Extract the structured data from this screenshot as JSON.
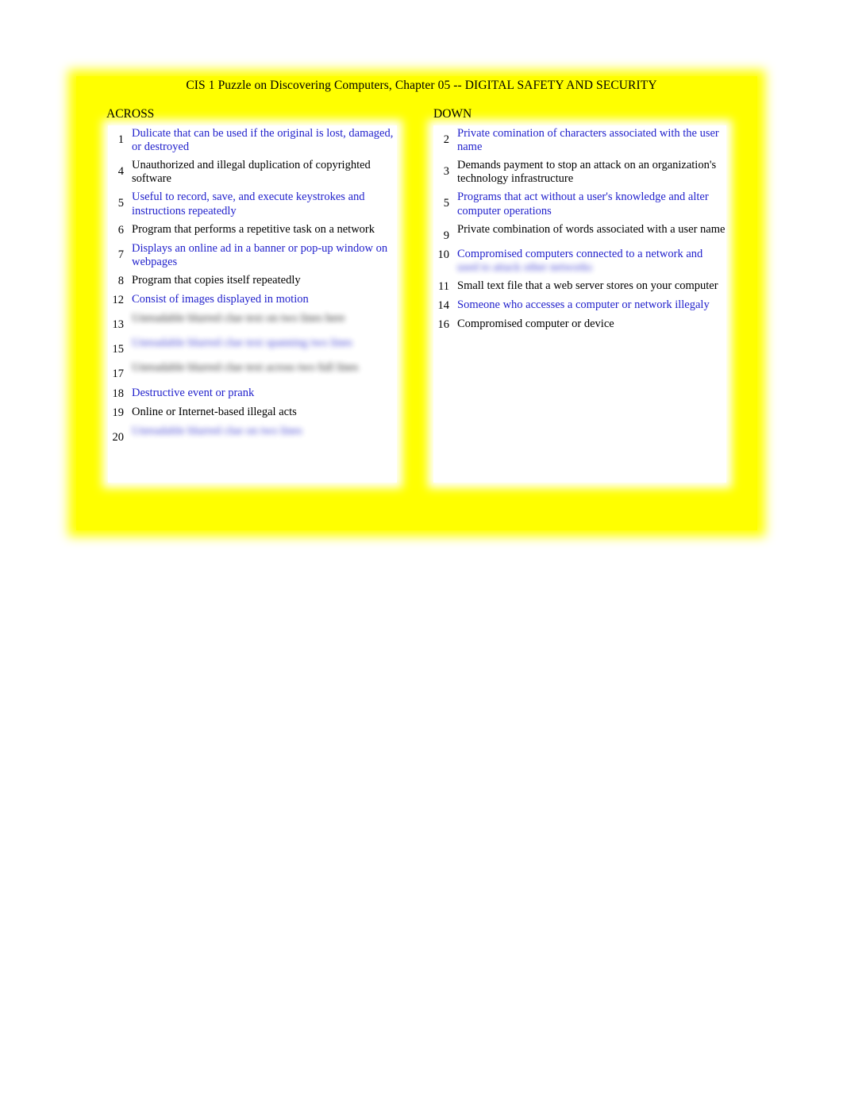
{
  "document": {
    "title": "CIS 1 Puzzle on Discovering Computers, Chapter 05 -- DIGITAL SAFETY AND SECURITY",
    "background_color": "#ffff00",
    "panel_color": "#ffffff",
    "clue_text_color": "#000000",
    "clue_link_color": "#2222cc"
  },
  "across": {
    "heading": "ACROSS",
    "clues": [
      {
        "number": "1",
        "text": "Dulicate that can be used if the original is lost, damaged, or destroyed",
        "style": "blue",
        "blurred": false,
        "lines": 2
      },
      {
        "number": "4",
        "text": "Unauthorized and illegal duplication of copyrighted software",
        "style": "black",
        "blurred": false,
        "lines": 2
      },
      {
        "number": "5",
        "text": "Useful to record, save, and execute keystrokes and instructions repeatedly",
        "style": "blue",
        "blurred": false,
        "lines": 2
      },
      {
        "number": "6",
        "text": "Program that performs a repetitive task on a network",
        "style": "black",
        "blurred": false,
        "lines": 1
      },
      {
        "number": "7",
        "text": "Displays an online ad in a banner or pop-up window on webpages",
        "style": "blue",
        "blurred": false,
        "lines": 2
      },
      {
        "number": "8",
        "text": "Program that copies itself repeatedly",
        "style": "black",
        "blurred": false,
        "lines": 1
      },
      {
        "number": "12",
        "text": "Consist of images displayed in motion",
        "style": "blue",
        "blurred": false,
        "lines": 1
      },
      {
        "number": "13",
        "text": "Unreadable blurred clue text on two lines here",
        "style": "black",
        "blurred": true,
        "lines": 2
      },
      {
        "number": "15",
        "text": "Unreadable blurred clue text spanning two lines",
        "style": "blue",
        "blurred": true,
        "lines": 2
      },
      {
        "number": "17",
        "text": "Unreadable blurred clue text across two full lines",
        "style": "black",
        "blurred": true,
        "lines": 2
      },
      {
        "number": "18",
        "text": "Destructive event or prank",
        "style": "blue",
        "blurred": false,
        "lines": 1
      },
      {
        "number": "19",
        "text": "Online or Internet-based illegal acts",
        "style": "black",
        "blurred": false,
        "lines": 1
      },
      {
        "number": "20",
        "text": "Unreadable blurred clue on two lines",
        "style": "blue",
        "blurred": true,
        "lines": 2
      }
    ]
  },
  "down": {
    "heading": "DOWN",
    "clues": [
      {
        "number": "2",
        "text": "Private comination of characters associated with the user name",
        "style": "blue",
        "blurred": false,
        "lines": 2
      },
      {
        "number": "3",
        "text": "Demands payment to stop an attack on an organization's technology infrastructure",
        "style": "black",
        "blurred": false,
        "lines": 2
      },
      {
        "number": "5",
        "text": "Programs that act without a user's knowledge and alter computer operations",
        "style": "blue",
        "blurred": false,
        "lines": 2
      },
      {
        "number": "9",
        "text": "Private combination of words associated with a user name",
        "style": "black",
        "blurred": false,
        "lines": 2
      },
      {
        "number": "10",
        "text": "Compromised computers connected to a network and",
        "style": "blue",
        "blurred": false,
        "lines": 1,
        "blurred_tail": "used to attack other networks"
      },
      {
        "number": "11",
        "text": "Small text file that a web server stores on your computer",
        "style": "black",
        "blurred": false,
        "lines": 1
      },
      {
        "number": "14",
        "text": "Someone who accesses a computer or network illegaly",
        "style": "blue",
        "blurred": false,
        "lines": 1
      },
      {
        "number": "16",
        "text": "Compromised computer or device",
        "style": "black",
        "blurred": false,
        "lines": 1
      }
    ]
  }
}
